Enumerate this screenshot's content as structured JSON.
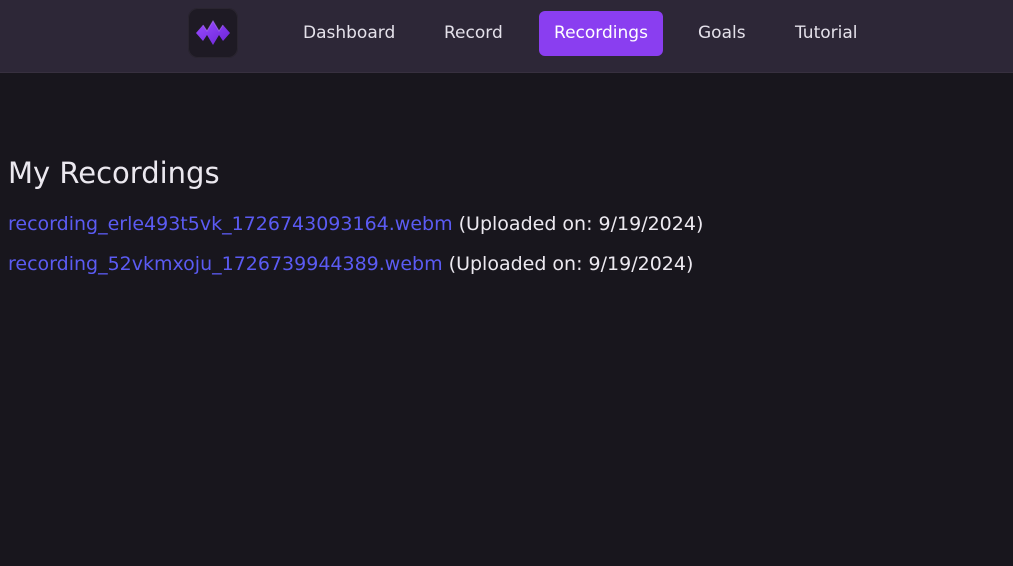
{
  "nav": {
    "logo_icon": "waveform-logo-icon",
    "items": [
      {
        "label": "Dashboard",
        "active": false
      },
      {
        "label": "Record",
        "active": false
      },
      {
        "label": "Recordings",
        "active": true
      },
      {
        "label": "Goals",
        "active": false
      },
      {
        "label": "Tutorial",
        "active": false
      }
    ]
  },
  "main": {
    "title": "My Recordings",
    "recordings": [
      {
        "filename": "recording_erle493t5vk_1726743093164.webm",
        "uploaded": "(Uploaded on: 9/19/2024)"
      },
      {
        "filename": "recording_52vkmxoju_1726739944389.webm",
        "uploaded": "(Uploaded on: 9/19/2024)"
      }
    ]
  },
  "colors": {
    "background": "#18161d",
    "topbar": "#2d2737",
    "accent": "#8a3ef0",
    "link": "#5b5bf3",
    "text": "#ece9f0"
  }
}
